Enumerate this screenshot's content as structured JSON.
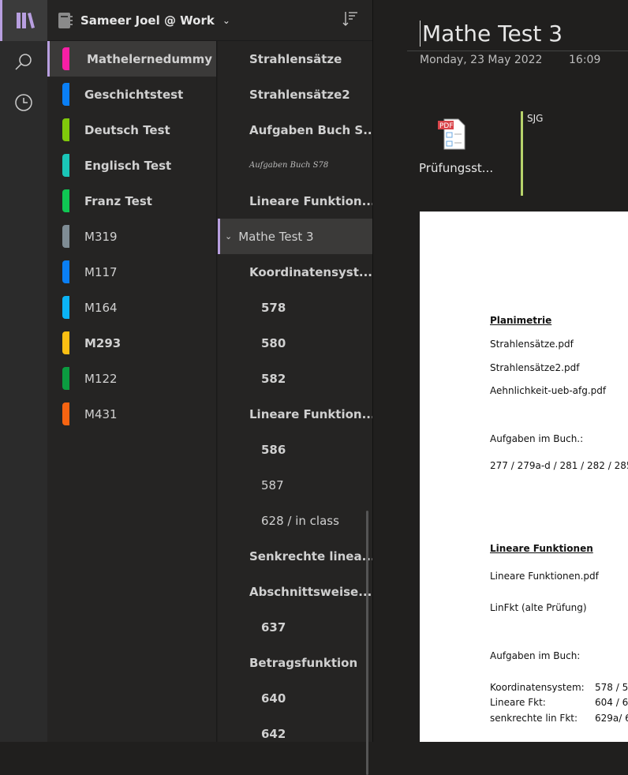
{
  "notebook": {
    "title": "Sameer Joel @ Work"
  },
  "sections": [
    {
      "label": "Mathelernedummy",
      "color": "#f71fa5",
      "bold": true,
      "selected": true
    },
    {
      "label": "Geschichtstest",
      "color": "#0a7ff5",
      "bold": true
    },
    {
      "label": "Deutsch Test",
      "color": "#80c90b",
      "bold": true
    },
    {
      "label": "Englisch Test",
      "color": "#1ac6b8",
      "bold": true
    },
    {
      "label": "Franz Test",
      "color": "#0fc753",
      "bold": true
    },
    {
      "label": "M319",
      "color": "#7f8c94",
      "bold": false
    },
    {
      "label": "M117",
      "color": "#0a7ff5",
      "bold": false
    },
    {
      "label": "M164",
      "color": "#0bb3f5",
      "bold": false
    },
    {
      "label": "M293",
      "color": "#fbbf13",
      "bold": true
    },
    {
      "label": "M122",
      "color": "#0b9c40",
      "bold": false
    },
    {
      "label": "M431",
      "color": "#f76411",
      "bold": false
    }
  ],
  "pages": [
    {
      "label": "Strahlensätze",
      "level": 1,
      "bold": true
    },
    {
      "label": "Strahlensätze2",
      "level": 1,
      "bold": true
    },
    {
      "label": "Aufgaben Buch S...",
      "level": 1,
      "bold": true
    },
    {
      "label": "Aufgaben Buch S78",
      "level": 1,
      "ink": true
    },
    {
      "label": "Lineare Funktion...",
      "level": 1,
      "bold": true
    },
    {
      "label": "Mathe Test 3",
      "level": 0,
      "selected": true
    },
    {
      "label": "Koordinatensyst...",
      "level": 1,
      "bold": true
    },
    {
      "label": "578",
      "level": 2,
      "bold": true
    },
    {
      "label": "580",
      "level": 2,
      "bold": true
    },
    {
      "label": "582",
      "level": 2,
      "bold": true
    },
    {
      "label": "Lineare Funktion...",
      "level": 1,
      "bold": true
    },
    {
      "label": "586",
      "level": 2,
      "bold": true
    },
    {
      "label": "587",
      "level": 2,
      "bold": false
    },
    {
      "label": "628 / in class",
      "level": 2,
      "bold": false
    },
    {
      "label": "Senkrechte linea...",
      "level": 1,
      "bold": true
    },
    {
      "label": "Abschnittsweise...",
      "level": 1,
      "bold": true
    },
    {
      "label": "637",
      "level": 2,
      "bold": true
    },
    {
      "label": "Betragsfunktion",
      "level": 1,
      "bold": true
    },
    {
      "label": "640",
      "level": 2,
      "bold": true
    },
    {
      "label": "642",
      "level": 2,
      "bold": true
    }
  ],
  "page": {
    "title": "Mathe Test 3",
    "date": "Monday, 23 May 2022",
    "time": "16:09",
    "attachment": {
      "label": "Prüfungsst...",
      "icon": "pdf-file-icon",
      "badge": "PDF"
    },
    "author": "SJG",
    "doc": {
      "h1": "Planimetrie",
      "f1": "Strahlensätze.pdf",
      "f2": "Strahlensätze2.pdf",
      "f3": "Aehnlichkeit-ueb-afg.pdf",
      "a1": "Aufgaben im Buch.:",
      "a1v": "277 / 279a-d / 281 / 282 / 285",
      "h2": "Lineare Funktionen",
      "f4": "Lineare Funktionen.pdf",
      "f5": "LinFkt (alte Prüfung)",
      "a2": "Aufgaben im Buch:",
      "r1k": "Koordinatensystem:",
      "r1v": "578 / 5",
      "r2k": "Lineare Fkt:",
      "r2v": "604 / 6",
      "r3k": "senkrechte lin Fkt:",
      "r3v": "629a/ 6"
    }
  }
}
